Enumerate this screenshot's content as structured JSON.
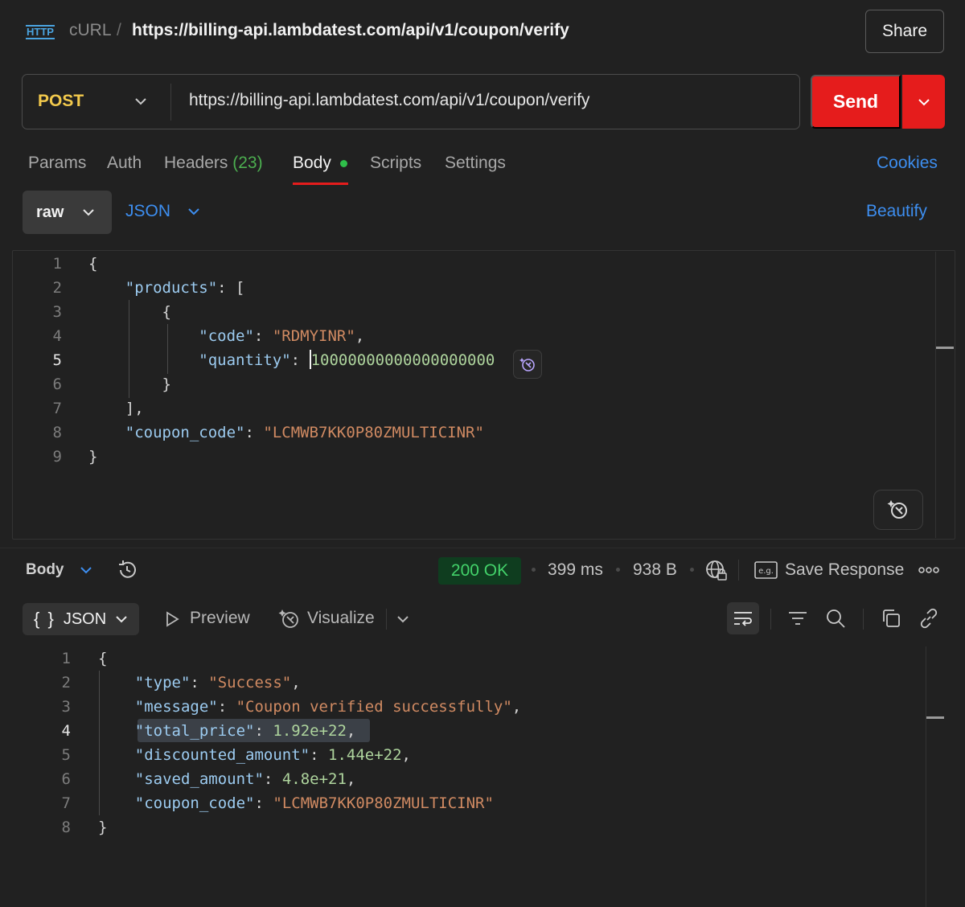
{
  "header": {
    "icon": "http-icon",
    "icon_text": "HTTP",
    "crumb_parent": "cURL",
    "crumb_sep": "/",
    "title": "https://billing-api.lambdatest.com/api/v1/coupon/verify",
    "share_label": "Share"
  },
  "request": {
    "method": "POST",
    "url": "https://billing-api.lambdatest.com/api/v1/coupon/verify",
    "send_label": "Send"
  },
  "tabs": {
    "params": "Params",
    "auth": "Auth",
    "headers": "Headers",
    "headers_count": "(23)",
    "body": "Body",
    "scripts": "Scripts",
    "settings": "Settings",
    "cookies": "Cookies"
  },
  "body_toolbar": {
    "mode": "raw",
    "format": "JSON",
    "beautify": "Beautify"
  },
  "request_body": {
    "line_numbers": [
      "1",
      "2",
      "3",
      "4",
      "5",
      "6",
      "7",
      "8",
      "9"
    ],
    "l1": "{",
    "products_key": "\"products\"",
    "products_open": ": [",
    "obj_open": "{",
    "code_key": "\"code\"",
    "colon": ": ",
    "code_val": "\"RDMYINR\"",
    "comma": ",",
    "quantity_key": "\"quantity\"",
    "quantity_val": "10000000000000000000",
    "obj_close": "}",
    "arr_close": "],",
    "coupon_key": "\"coupon_code\"",
    "coupon_val": "\"LCMWB7KK0P80ZMULTICINR\"",
    "l9": "}"
  },
  "response_bar": {
    "body_label": "Body",
    "status": "200 OK",
    "time": "399 ms",
    "size": "938 B",
    "save_response": "Save Response",
    "format": "JSON",
    "format_braces": "{ }",
    "preview": "Preview",
    "visualize": "Visualize",
    "status_color": "#43d26a"
  },
  "response_body": {
    "line_numbers": [
      "1",
      "2",
      "3",
      "4",
      "5",
      "6",
      "7",
      "8"
    ],
    "open": "{",
    "type_key": "\"type\"",
    "type_val": "\"Success\"",
    "message_key": "\"message\"",
    "message_val": "\"Coupon verified successfully\"",
    "total_key": "\"total_price\"",
    "total_val": "1.92e+22",
    "discounted_key": "\"discounted_amount\"",
    "discounted_val": "1.44e+22",
    "saved_key": "\"saved_amount\"",
    "saved_val": "4.8e+21",
    "coupon_key": "\"coupon_code\"",
    "coupon_val": "\"LCMWB7KK0P80ZMULTICINR\"",
    "close": "}"
  },
  "colors": {
    "accent_send": "#e51c1c",
    "link_blue": "#3d8ef0",
    "method_yellow": "#f2c94c"
  }
}
